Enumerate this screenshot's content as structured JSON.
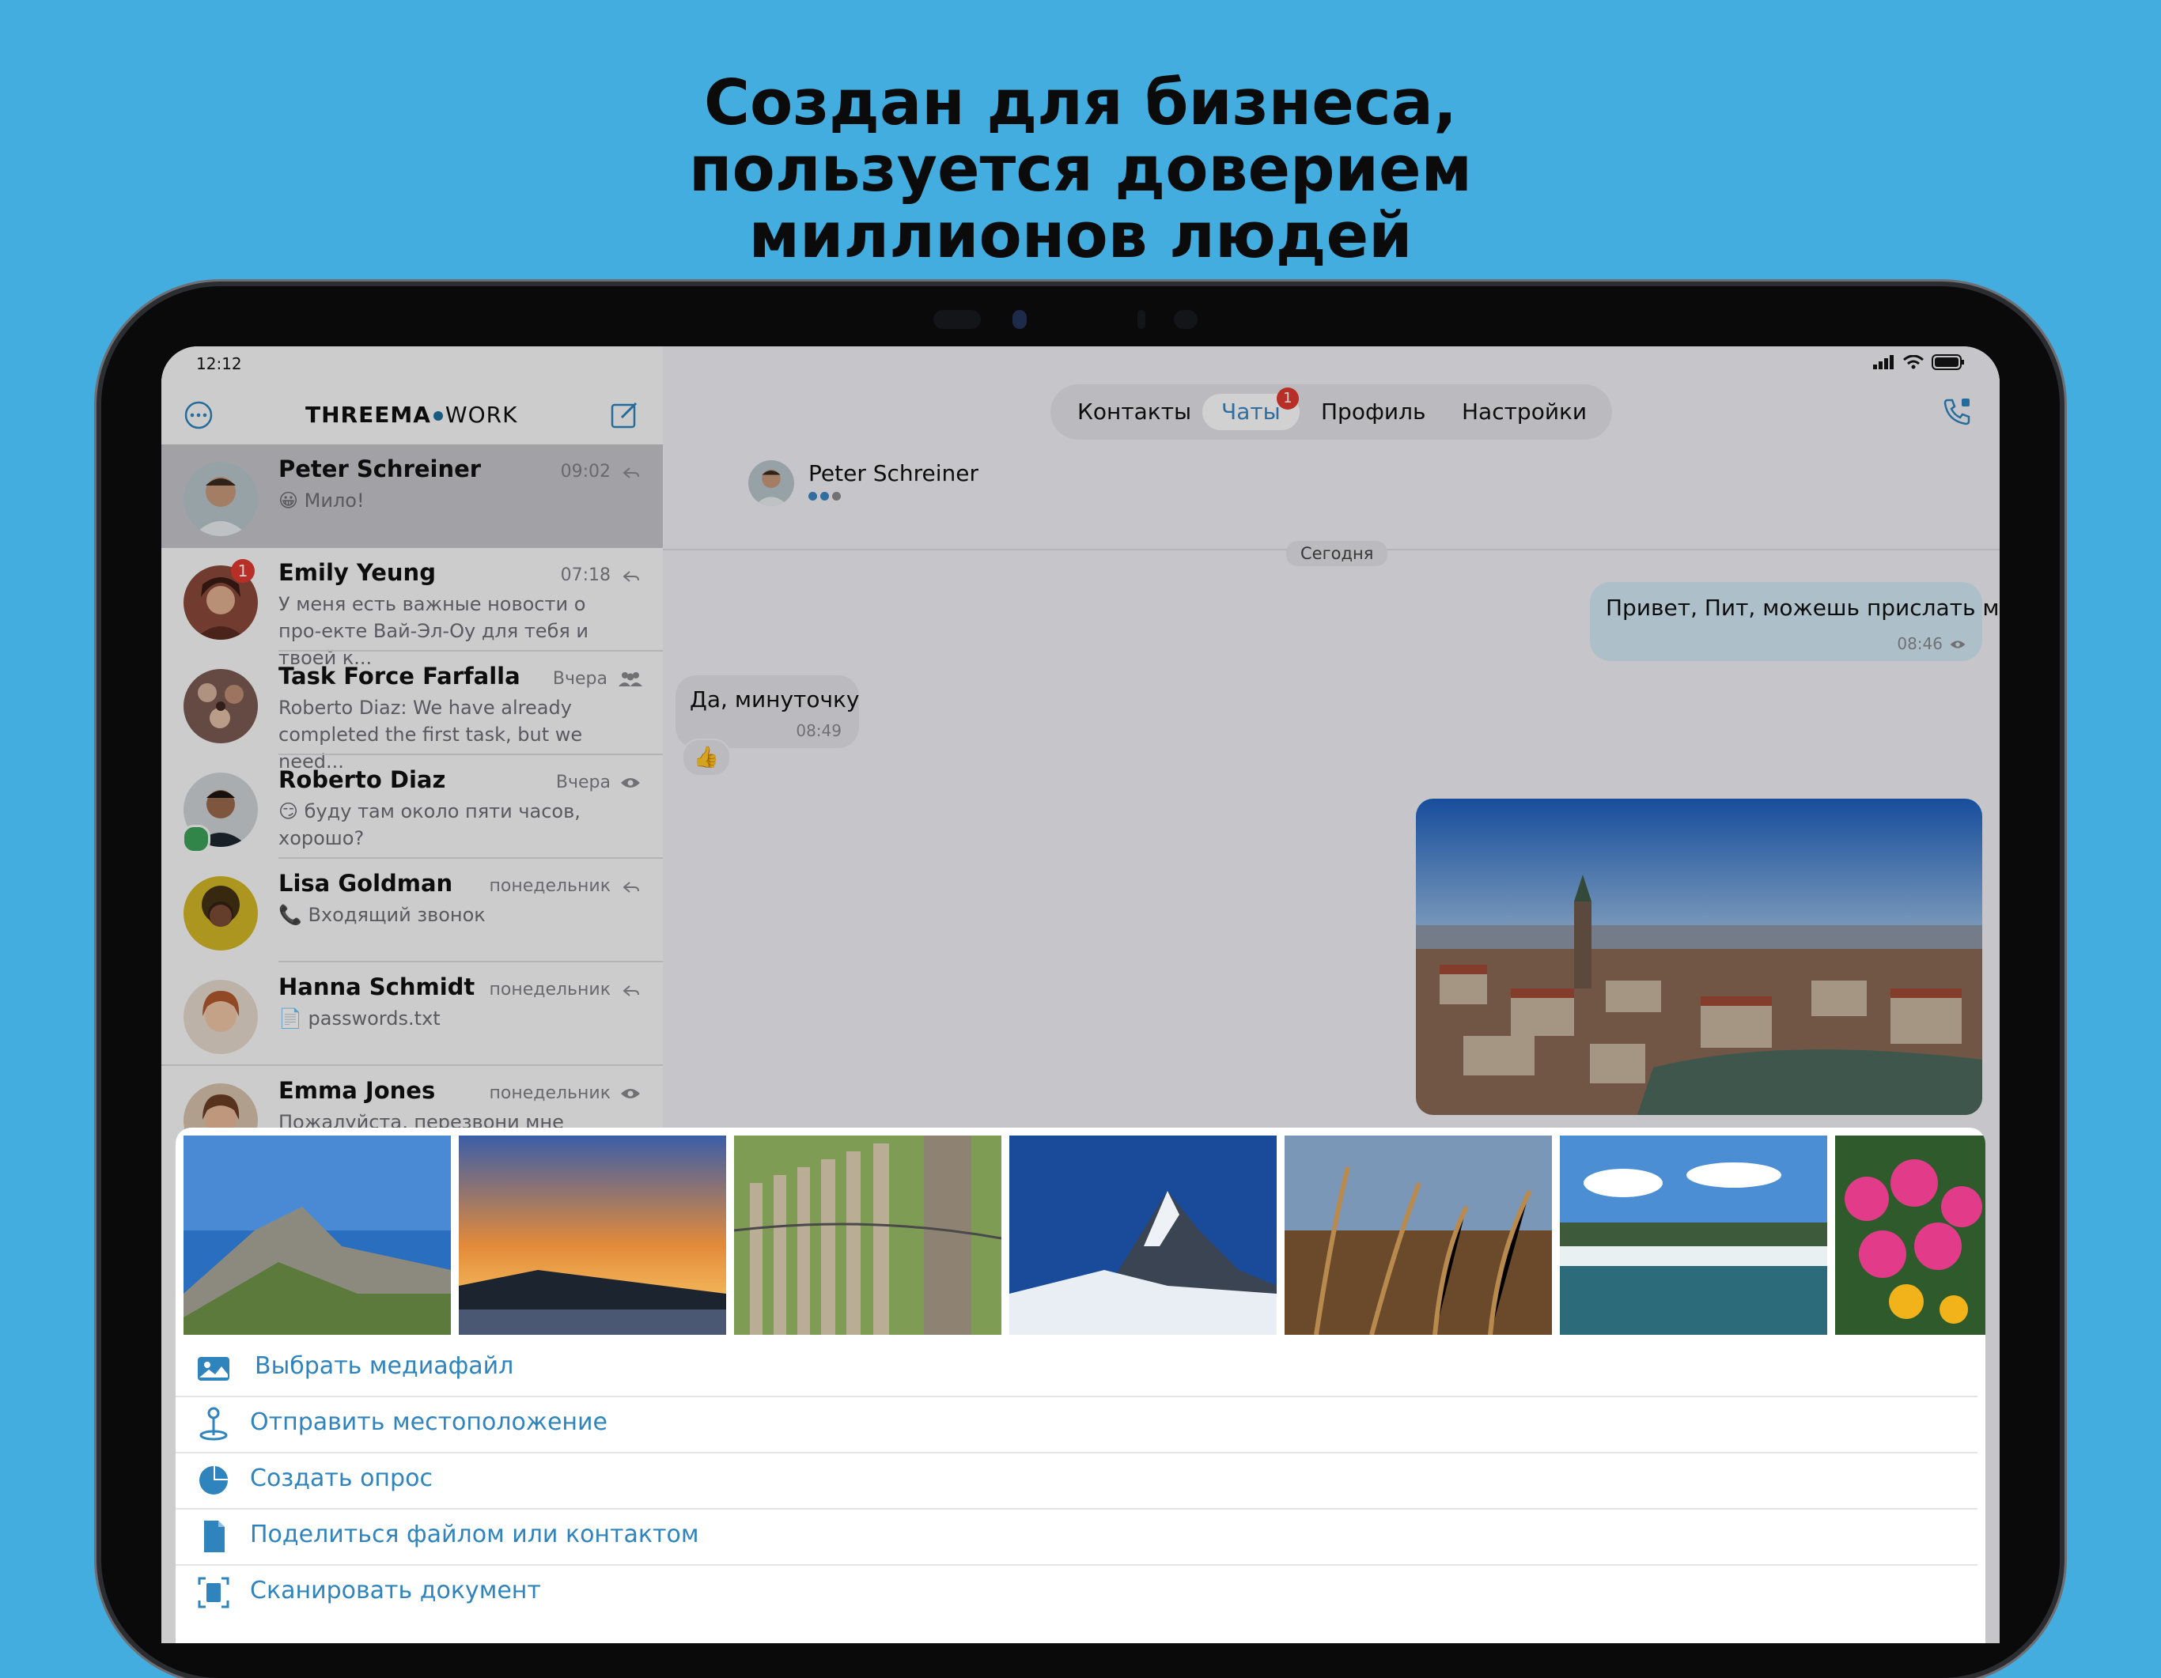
{
  "headline": [
    "Создан для бизнеса,",
    "пользуется доверием",
    "миллионов людей"
  ],
  "status": {
    "time": "12:12"
  },
  "sidebar": {
    "logo_left": "THREEMA",
    "logo_right": "WORK",
    "chats": [
      {
        "name": "Peter Schreiner",
        "time": "09:02",
        "preview": "😀 Мило!",
        "indicator": "reply-icon"
      },
      {
        "name": "Emily Yeung",
        "time": "07:18",
        "preview": "У меня есть важные новости о про-екте Вай-Эл-Оу для тебя и твоей к...",
        "badge": "1",
        "indicator": "reply-icon"
      },
      {
        "name": "Task Force Farfalla",
        "time": "Вчера",
        "preview": "Roberto Diaz: We have already completed the first task, but we need...",
        "indicator": "group-icon"
      },
      {
        "name": "Roberto Diaz",
        "time": "Вчера",
        "preview": "😏 буду там около пяти часов, хорошо?",
        "indicator": "eye-icon"
      },
      {
        "name": "Lisa Goldman",
        "time": "понедельник",
        "preview": "📞 Входящий звонок",
        "indicator": "reply-icon"
      },
      {
        "name": "Hanna Schmidt",
        "time": "понедельник",
        "preview": "📄 passwords.txt",
        "indicator": "reply-icon"
      },
      {
        "name": "Emma Jones",
        "time": "понедельник",
        "preview": "Пожалуйста, перезвони мне",
        "indicator": "eye-icon"
      }
    ]
  },
  "tabs": {
    "contacts": "Контакты",
    "chats": "Чаты",
    "chats_badge": "1",
    "profile": "Профиль",
    "settings": "Настройки"
  },
  "conversation": {
    "contact_name": "Peter Schreiner",
    "date_label": "Сегодня",
    "messages": [
      {
        "text": "Привет, Пит, можешь прислать мне новый отчет?",
        "time": "08:46"
      },
      {
        "text": "Да, минуточку",
        "time": "08:49",
        "reaction": "👍"
      }
    ]
  },
  "sheet": {
    "thumbnails": [
      "mountain-thumbnail",
      "sunset-thumbnail",
      "fence-thumbnail",
      "matterhorn-thumbnail",
      "wheat-thumbnail",
      "waterfall-thumbnail",
      "flowers-thumbnail"
    ],
    "actions": [
      {
        "label": "Выбрать медиафайл",
        "icon": "image-icon"
      },
      {
        "label": "Отправить местоположение",
        "icon": "location-pin-icon"
      },
      {
        "label": "Создать опрос",
        "icon": "poll-pie-icon"
      },
      {
        "label": "Поделиться файлом или контактом",
        "icon": "file-icon"
      },
      {
        "label": "Сканировать документ",
        "icon": "scan-icon"
      }
    ]
  },
  "colors": {
    "background": "#43ade0",
    "accent": "#2f84bd",
    "badge": "#e03a2f"
  }
}
